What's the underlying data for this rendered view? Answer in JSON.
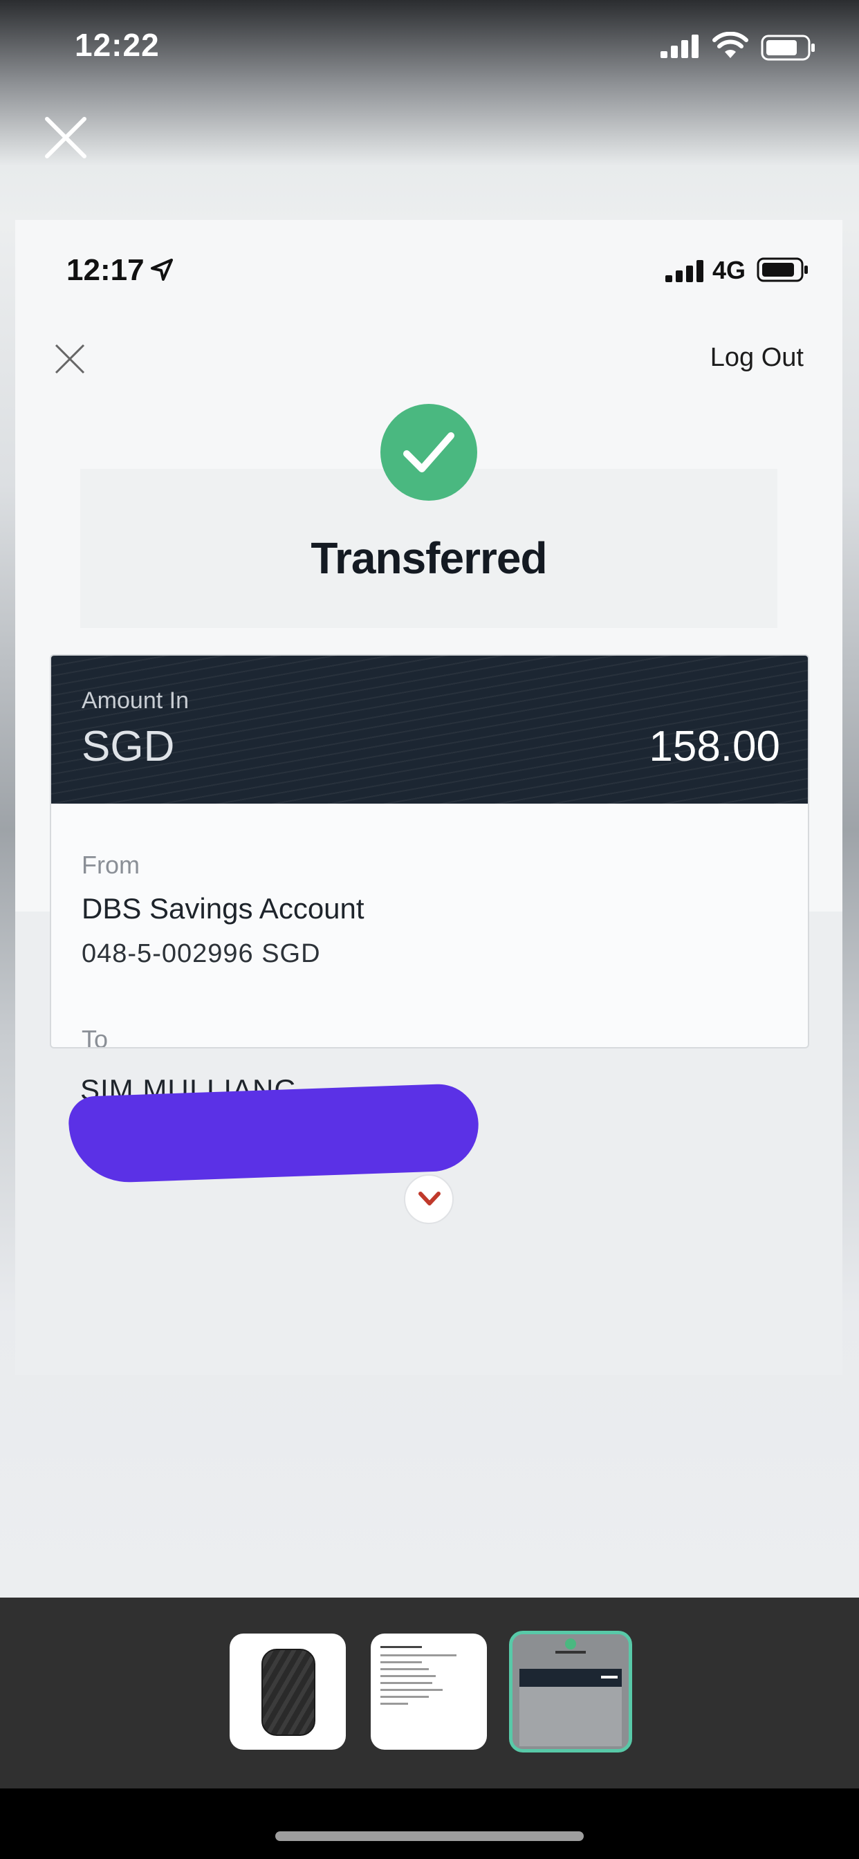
{
  "outer_status": {
    "time": "12:22"
  },
  "inner_status": {
    "time": "12:17",
    "network": "4G"
  },
  "header": {
    "logout_label": "Log Out",
    "title": "Transferred"
  },
  "amount": {
    "label": "Amount In",
    "currency": "SGD",
    "value": "158.00"
  },
  "from": {
    "label": "From",
    "account_name": "DBS Savings Account",
    "account_number": "048-5-002996 SGD"
  },
  "to": {
    "label": "To",
    "name": "SIM MUI LIANG"
  },
  "thumbnails": [
    {
      "name": "quilted-phone-bag-photo"
    },
    {
      "name": "view-details-document"
    },
    {
      "name": "transferred-receipt-screenshot",
      "selected": true
    }
  ],
  "colors": {
    "success": "#4ab880",
    "band": "#1c2632",
    "redaction": "#5b31e6",
    "selected_thumb": "#58c9a8",
    "chevron": "#c0392b"
  }
}
